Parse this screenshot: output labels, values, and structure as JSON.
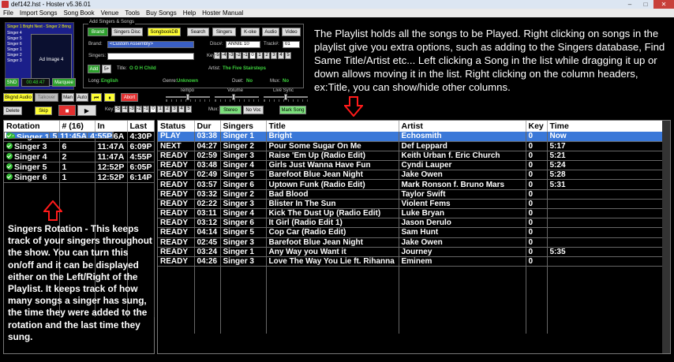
{
  "window": {
    "title": "def142.hst - Hoster v5.36.01",
    "min": "–",
    "max": "□",
    "close": "✕"
  },
  "menu": [
    "File",
    "Import Songs",
    "Song Book",
    "Venue",
    "Tools",
    "Buy Songs",
    "Help",
    "Hoster Manual"
  ],
  "video": {
    "top": "Singer 1  Bright  Next - Singer 2  Bring Sugar",
    "left": [
      "Singer 4",
      "Singer 5",
      "Singer 6",
      "Singer 1",
      "Singer 2",
      "Singer 3"
    ],
    "box": "Ad Image 4"
  },
  "left_controls": {
    "snd": "SND",
    "time": "00:48:47",
    "marquee": "Marquee",
    "bkgnd_audio": "Bkgnd Audio",
    "talkover": "Talkover",
    "man": "Man",
    "auto": "Auto",
    "abort": "Abort",
    "delete": "Delete",
    "skip": "Skip"
  },
  "add_box": {
    "legend": "Add Singers & Songs",
    "buttons": [
      "Brand",
      "Singers Disc",
      "SongbookDB",
      "Search",
      "Singers",
      "K-oke",
      "Audio",
      "Video"
    ],
    "brand_label": "Brand:",
    "brand_value": "<Custom Assembly>",
    "singers_label": "Singers:",
    "disc_label": "Disc#:",
    "disc_value": "ANNIE 10",
    "track_label": "Track#:",
    "track_value": "01",
    "key_label": "Key:",
    "add": "Add",
    "five": "5+",
    "title_label": "Title:",
    "title_value": "O O H Child",
    "artist_label": "Artist:",
    "artist_value": "The Five Stairsteps",
    "long_label": "Long:",
    "long_value": "English",
    "genre_label": "Genre:",
    "genre_value": "Unknown",
    "duet_label": "Duet:",
    "duet_value": "No",
    "mux_label": "Mux:",
    "mux_value": "No"
  },
  "keys": [
    "-5",
    "-4",
    "-3",
    "-2",
    "-1",
    "0",
    "1",
    "2",
    "3",
    "4",
    "5"
  ],
  "sliders": {
    "tempo": "Tempo",
    "volume": "Volume",
    "live_sync": "Live Sync"
  },
  "mux": {
    "label": "Mux:",
    "stereo": "Stereo",
    "novoc": "No Voc",
    "mark_song": "Mark Song"
  },
  "help_playlist": "The Playlist holds all the songs to be Played. Right clicking on songs in the playlist give you extra options, such as adding to the Singers database, Find Same Title/Artist etc... Left clicking a Song in the list while dragging it up or down allows moving it in the list. Right clicking on the column headers, ex:Title, you can show/hide other columns.",
  "help_rotation": "Singers Rotation - This keeps track of your singers throughout the show. You can turn this on/off and it can be displayed either on the Left/Right of the Playlist. It keeps track of how many songs a singer has sung, the time they were added to the rotation and the last time they sung.",
  "rotation": {
    "headers": [
      "Rotation",
      "# (16)",
      "In",
      "Last"
    ],
    "rows": [
      [
        "Singer 1",
        "5",
        "11:45A",
        "4:55P"
      ],
      [
        "Singer 2",
        "1",
        "11:46A",
        "4:30P"
      ],
      [
        "Singer 3",
        "6",
        "11:47A",
        "6:09P"
      ],
      [
        "Singer 4",
        "2",
        "11:47A",
        "4:55P"
      ],
      [
        "Singer 5",
        "1",
        "12:52P",
        "6:05P"
      ],
      [
        "Singer 6",
        "1",
        "12:52P",
        "6:14P"
      ]
    ]
  },
  "playlist": {
    "headers": [
      "Status",
      "Dur",
      "Singers",
      "Title",
      "Artist",
      "Key",
      "Time"
    ],
    "rows": [
      [
        "PLAY",
        "03:38",
        "Singer 1",
        "Bright",
        "Echosmith",
        "0",
        "Now"
      ],
      [
        "NEXT",
        "04:27",
        "Singer 2",
        "Pour Some Sugar On Me",
        "Def Leppard",
        "0",
        "5:17"
      ],
      [
        "READY",
        "02:59",
        "Singer 3",
        "Raise 'Em Up (Radio Edit)",
        "Keith Urban f. Eric Church",
        "0",
        "5:21"
      ],
      [
        "READY",
        "03:48",
        "Singer 4",
        "Girls Just Wanna Have Fun",
        "Cyndi Lauper",
        "0",
        "5:24"
      ],
      [
        "READY",
        "02:49",
        "Singer 5",
        "Barefoot Blue Jean Night",
        "Jake Owen",
        "0",
        "5:28"
      ],
      [
        "READY",
        "03:57",
        "Singer 6",
        "Uptown Funk (Radio Edit)",
        "Mark Ronson f. Bruno Mars",
        "0",
        "5:31"
      ],
      [
        "READY",
        "03:32",
        "Singer 2",
        "Bad Blood",
        "Taylor Swift",
        "0",
        ""
      ],
      [
        "READY",
        "02:22",
        "Singer 3",
        "Blister In The Sun",
        "Violent Fems",
        "0",
        ""
      ],
      [
        "READY",
        "03:11",
        "Singer 4",
        "Kick The Dust Up (Radio Edit)",
        "Luke Bryan",
        "0",
        ""
      ],
      [
        "READY",
        "03:12",
        "Singer 6",
        "It Girl (Radio Edit 1)",
        "Jason Derulo",
        "0",
        ""
      ],
      [
        "READY",
        "04:14",
        "Singer 5",
        "Cop Car (Radio Edit)",
        "Sam Hunt",
        "0",
        ""
      ],
      [
        "READY",
        "02:45",
        "Singer 3",
        "Barefoot Blue Jean Night",
        "Jake Owen",
        "0",
        ""
      ],
      [
        "READY",
        "03:24",
        "Singer 1",
        " Any Way you Want it",
        "Journey",
        "0",
        "5:35"
      ],
      [
        "READY",
        "04:26",
        "Singer 3",
        "Love The Way You Lie ft. Rihanna",
        "Eminem",
        "0",
        ""
      ]
    ]
  },
  "colors": {
    "play_bg": "#1a9a1a",
    "next": "#4fd0ff",
    "ready": "#ffe21a",
    "selected": "#3a78d8",
    "arrow": "#ff1a1a"
  }
}
